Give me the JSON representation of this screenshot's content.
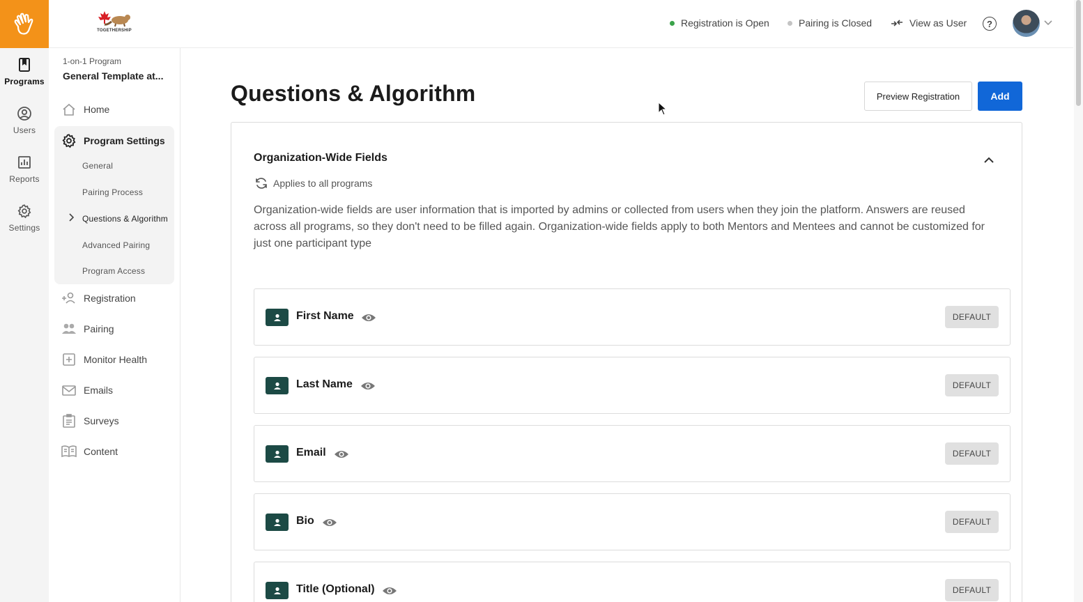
{
  "rail": {
    "items": [
      {
        "label": "Programs",
        "icon": "bookmark-book-icon",
        "active": true
      },
      {
        "label": "Users",
        "icon": "user-circle-icon",
        "active": false
      },
      {
        "label": "Reports",
        "icon": "bar-chart-icon",
        "active": false
      },
      {
        "label": "Settings",
        "icon": "gear-icon",
        "active": false
      }
    ]
  },
  "topbar": {
    "brand_text": "TOGETHERSHIP",
    "registration_status": "Registration is Open",
    "pairing_status": "Pairing is Closed",
    "view_as_user": "View as User",
    "colors": {
      "open": "#3aa34a",
      "closed": "#c4c4c4",
      "logo_bg": "#f39219"
    }
  },
  "sidebar": {
    "program_type": "1-on-1 Program",
    "program_name": "General Template at...",
    "home": "Home",
    "program_settings": "Program Settings",
    "settings_items": [
      "General",
      "Pairing Process",
      "Questions & Algorithm",
      "Advanced Pairing",
      "Program Access"
    ],
    "registration": "Registration",
    "pairing": "Pairing",
    "monitor_health": "Monitor Health",
    "emails": "Emails",
    "surveys": "Surveys",
    "content": "Content"
  },
  "main": {
    "title": "Questions & Algorithm",
    "preview_button": "Preview Registration",
    "add_button": "Add",
    "accent": "#1167d8"
  },
  "panel": {
    "title": "Organization-Wide Fields",
    "applies": "Applies to all programs",
    "description": "Organization-wide fields are user information that is imported by admins or collected from users when they join the platform. Answers are reused across all programs, so they don't need to be filled again. Organization-wide fields apply to both Mentors and Mentees and cannot be customized for just one participant type",
    "fields": [
      {
        "name": "First Name",
        "badge": "DEFAULT"
      },
      {
        "name": "Last Name",
        "badge": "DEFAULT"
      },
      {
        "name": "Email",
        "badge": "DEFAULT"
      },
      {
        "name": "Bio",
        "badge": "DEFAULT"
      },
      {
        "name": "Title (Optional)",
        "badge": "DEFAULT"
      }
    ],
    "field_icon_color": "#1c4a45"
  }
}
